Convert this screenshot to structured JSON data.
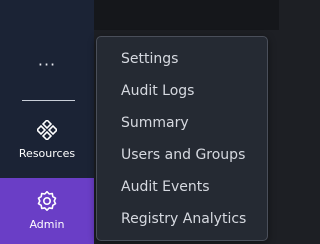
{
  "sidebar": {
    "more_label": "···",
    "items": [
      {
        "label": "Resources",
        "icon": "resources-icon"
      },
      {
        "label": "Admin",
        "icon": "gear-icon",
        "active": true
      }
    ]
  },
  "menu": {
    "items": [
      {
        "label": "Settings"
      },
      {
        "label": "Audit Logs"
      },
      {
        "label": "Summary"
      },
      {
        "label": "Users and Groups"
      },
      {
        "label": "Audit Events"
      },
      {
        "label": "Registry Analytics"
      }
    ]
  },
  "colors": {
    "sidebar_bg": "#1b2335",
    "active_bg": "#6a3ec6",
    "menu_bg": "#252a33",
    "menu_border": "#4a4f5a",
    "text": "#ffffff",
    "menu_text": "#d6d9e0"
  }
}
